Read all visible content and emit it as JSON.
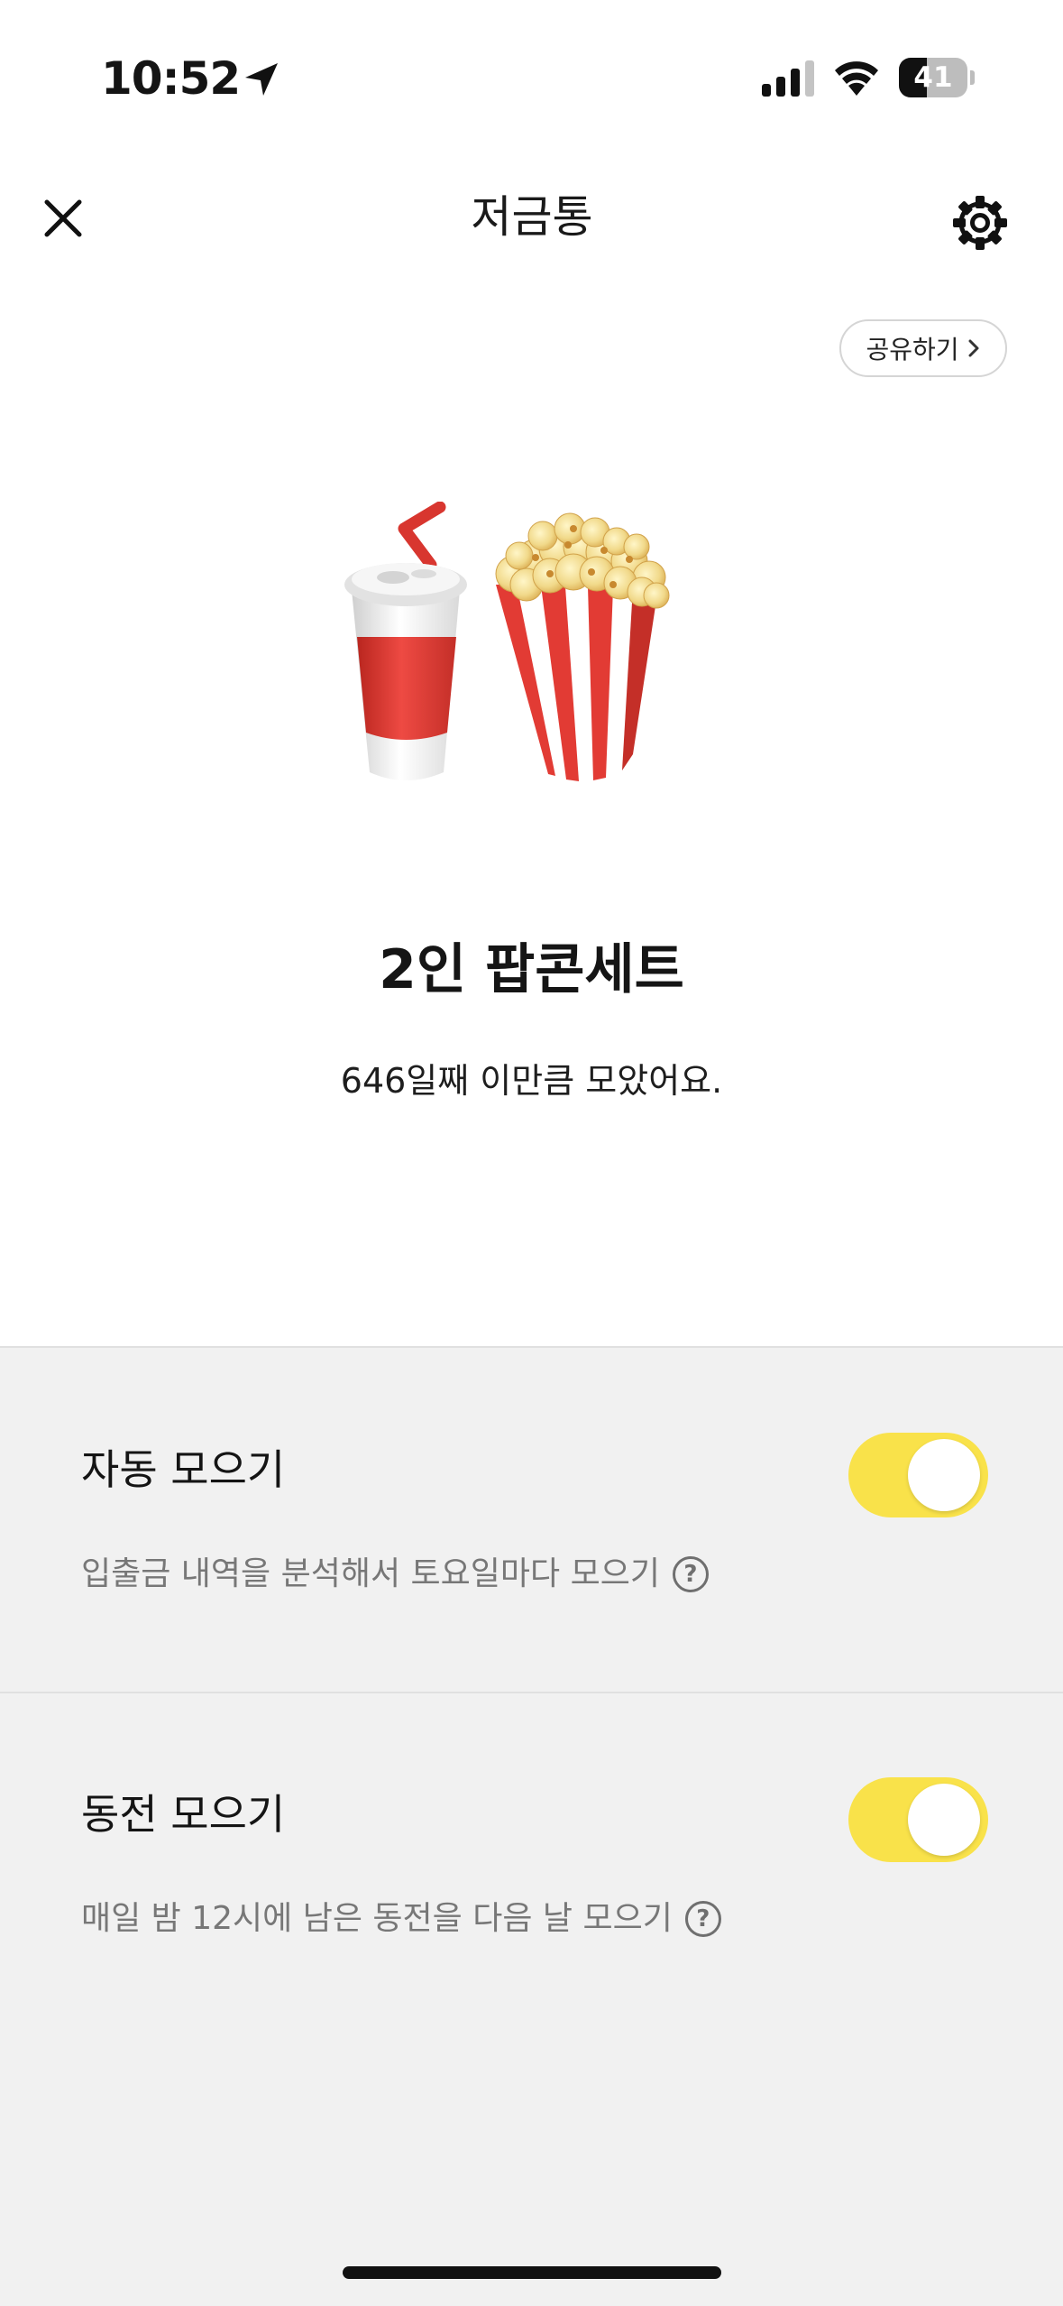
{
  "status_bar": {
    "time": "10:52",
    "battery_level": "41",
    "battery_fraction": 0.41
  },
  "nav": {
    "title": "저금통",
    "close_icon": "close-icon",
    "settings_icon": "gear-icon"
  },
  "share_button": {
    "label": "공유하기",
    "icon": "chevron-right-icon"
  },
  "goal": {
    "illustration": "popcorn-and-soda",
    "title": "2인 팝콘세트",
    "description": "646일째 이만큼 모았어요."
  },
  "settings": [
    {
      "title": "자동 모으기",
      "description": "입출금 내역을 분석해서 토요일마다 모으기",
      "enabled": true
    },
    {
      "title": "동전 모으기",
      "description": "매일 밤 12시에 남은 동전을 다음 날 모으기",
      "enabled": true
    }
  ],
  "colors": {
    "toggle_on": "#f9e24a",
    "background": "#f1f1f1",
    "accent_red": "#e23b34"
  }
}
